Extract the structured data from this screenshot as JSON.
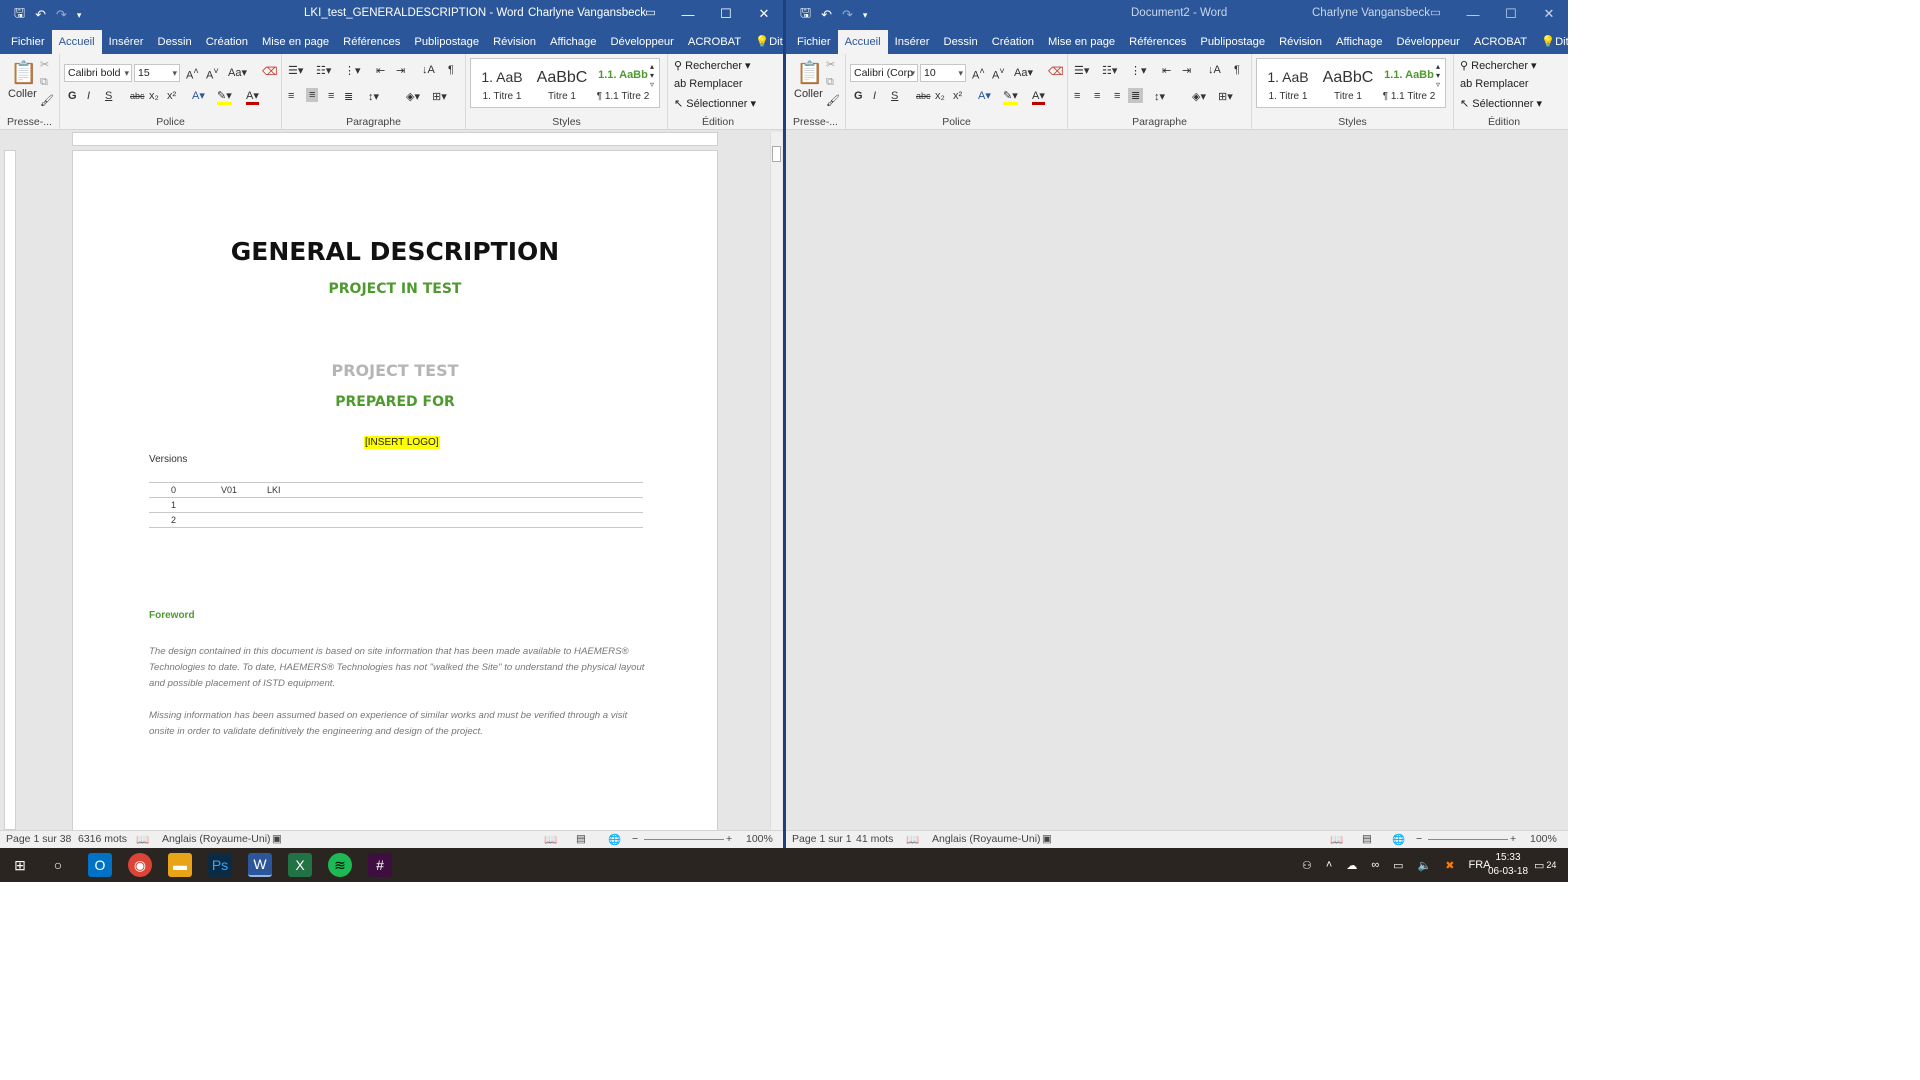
{
  "left_window": {
    "title": "LKI_test_GENERALDESCRIPTION  -  Word",
    "user": "Charlyne Vangansbeck",
    "tabs": [
      "Fichier",
      "Accueil",
      "Insérer",
      "Dessin",
      "Création",
      "Mise en page",
      "Références",
      "Publipostage",
      "Révision",
      "Affichage",
      "Développeur",
      "ACROBAT",
      "Dites-le-r"
    ],
    "active_tab": "Accueil",
    "font_name": "Calibri bold",
    "font_size": "15",
    "status": {
      "page": "Page 1 sur 38",
      "words": "6316 mots",
      "language": "Anglais (Royaume-Uni)",
      "zoom": "100%"
    },
    "document": {
      "title": "GENERAL DESCRIPTION",
      "subtitle": "PROJECT IN TEST",
      "project": "PROJECT TEST",
      "prepared_for": "PREPARED FOR",
      "logo_placeholder": "[INSERT LOGO]",
      "versions_label": "Versions",
      "versions": [
        {
          "num": "0",
          "version": "V01",
          "author": "LKI"
        },
        {
          "num": "1",
          "version": "",
          "author": ""
        },
        {
          "num": "2",
          "version": "",
          "author": ""
        }
      ],
      "foreword_title": "Foreword",
      "paragraph1": "The design contained in this document is based on site information that has been made available to HAEMERS® Technologies to date. To date, HAEMERS® Technologies has not \"walked the Site\" to understand the physical layout and possible placement of ISTD equipment.",
      "paragraph2": "Missing information has been assumed based on experience of similar works and must be verified through a visit onsite in order to validate definitively the engineering and design of the project."
    }
  },
  "right_window": {
    "title": "Document2  -  Word",
    "user": "Charlyne Vangansbeck",
    "tabs": [
      "Fichier",
      "Accueil",
      "Insérer",
      "Dessin",
      "Création",
      "Mise en page",
      "Références",
      "Publipostage",
      "Révision",
      "Affichage",
      "Développeur",
      "ACROBAT",
      "Dites-le-r"
    ],
    "font_name": "Calibri (Corp",
    "font_size": "10",
    "status": {
      "page": "Page 1 sur 1",
      "words": "41 mots",
      "language": "Anglais (Royaume-Uni)",
      "zoom": "100%"
    }
  },
  "ribbon": {
    "coller": "Coller",
    "groups": {
      "clipboard": "Presse-...",
      "police": "Police",
      "paragraphe": "Paragraphe",
      "styles": "Styles",
      "edition": "Édition"
    },
    "styles": [
      {
        "preview": "1.  AaB",
        "name": "1. Titre 1"
      },
      {
        "preview": "AaBbC",
        "name": "Titre 1"
      },
      {
        "preview": "1.1.  AaBb",
        "name": "¶ 1.1 Titre 2"
      }
    ],
    "edit": {
      "find": "Rechercher",
      "replace": "Remplacer",
      "select": "Sélectionner"
    },
    "format_letters": {
      "bold": "G",
      "italic": "I",
      "underline": "S",
      "strike": "abc",
      "sub": "x₂",
      "sup": "x²"
    }
  },
  "taskbar": {
    "language": "FRA",
    "time": "15:33",
    "date": "06-03-18",
    "notifications": "24"
  },
  "colors": {
    "word_blue": "#2b579a",
    "heading_green": "#4e9a2f",
    "highlight": "#ffff00"
  }
}
